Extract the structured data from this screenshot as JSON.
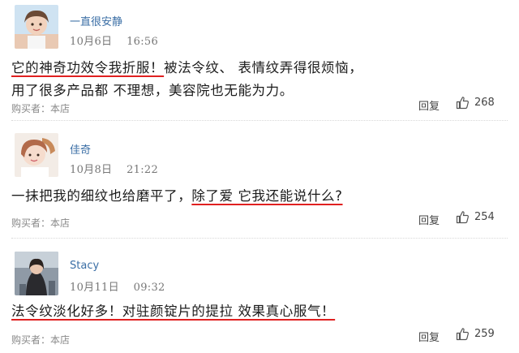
{
  "comments": [
    {
      "username": "一直很安静",
      "date": "10月6日",
      "time": "16:56",
      "lines": [
        [
          {
            "text": "它的神奇功效令我折服！",
            "underline": true
          },
          {
            "text": "被法令纹、 表情纹弄得很烦恼，",
            "underline": false
          }
        ],
        [
          {
            "text": "用了很多产品都 不理想，美容院也无能为力。",
            "underline": false
          }
        ]
      ],
      "buyer": "购买者：本店",
      "reply": "回复",
      "likes": "268"
    },
    {
      "username": "佳奇",
      "date": "10月8日",
      "time": "21:22",
      "lines": [
        [
          {
            "text": "一抹把我的细纹也给磨平了，",
            "underline": false
          },
          {
            "text": "除了爱 它我还能说什么?",
            "underline": true
          }
        ]
      ],
      "buyer": "购买者：本店",
      "reply": "回复",
      "likes": "254"
    },
    {
      "username": "Stacy",
      "date": "10月11日",
      "time": "09:32",
      "lines": [
        [
          {
            "text": "法令纹淡化好多！对驻颜锭片的提拉 效果真心服气！",
            "underline": true
          }
        ]
      ],
      "buyer": "购买者：本店",
      "reply": "回复",
      "likes": "259"
    }
  ],
  "icons": {
    "like": "thumbs-up-icon"
  },
  "colors": {
    "username": "#3a6ea5",
    "underline": "#e02020",
    "meta": "#777777"
  }
}
